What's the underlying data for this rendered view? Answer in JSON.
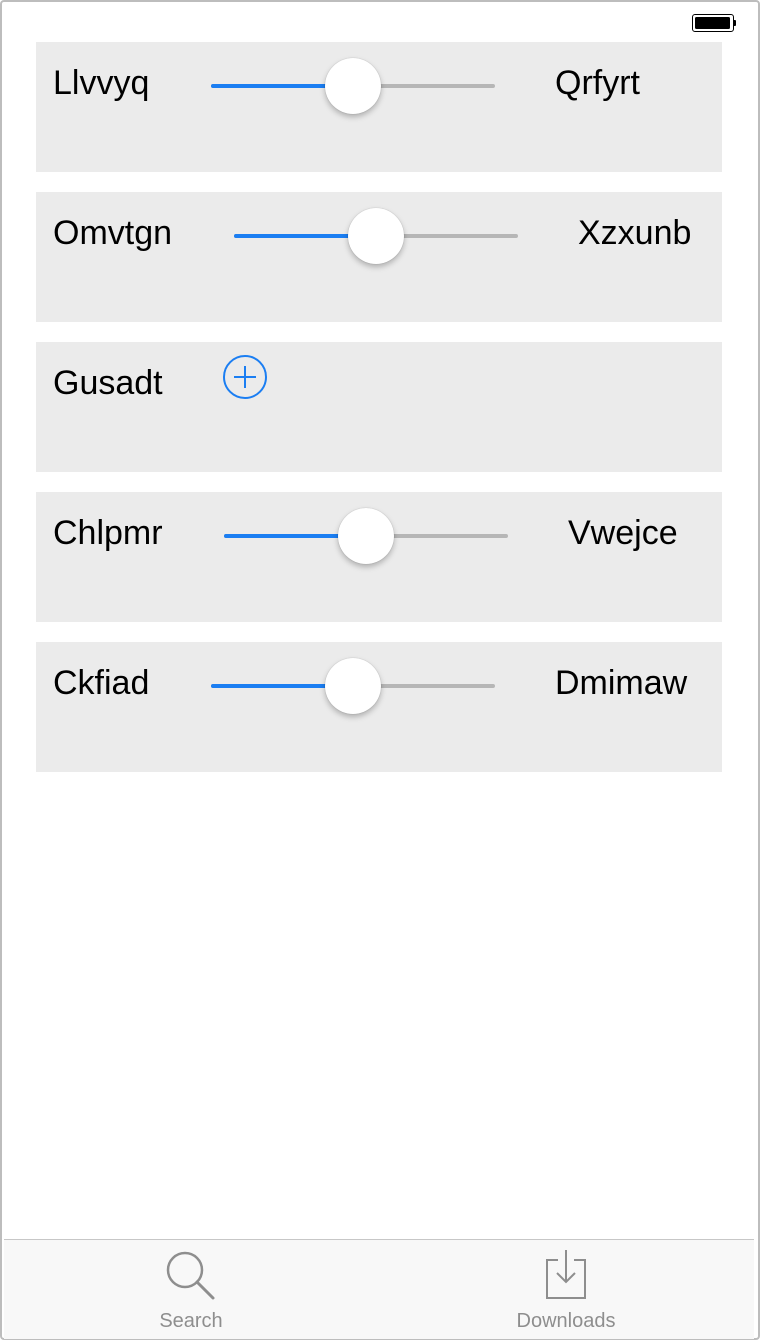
{
  "status_bar": {
    "battery_level": 1.0
  },
  "accent_color": "#1b7ef2",
  "rows": [
    {
      "type": "slider",
      "left_label": "Llvvyq",
      "right_label": "Qrfyrt",
      "value": 0.5
    },
    {
      "type": "slider",
      "left_label": "Omvtgn",
      "right_label": "Xzxunb",
      "value": 0.5
    },
    {
      "type": "button",
      "left_label": "Gusadt",
      "icon": "plus-circle-icon"
    },
    {
      "type": "slider",
      "left_label": "Chlpmr",
      "right_label": "Vwejce",
      "value": 0.5
    },
    {
      "type": "slider",
      "left_label": "Ckfiad",
      "right_label": "Dmimaw",
      "value": 0.5
    }
  ],
  "tabbar": {
    "tabs": [
      {
        "label": "Search",
        "icon": "search-icon"
      },
      {
        "label": "Downloads",
        "icon": "download-icon"
      }
    ]
  }
}
